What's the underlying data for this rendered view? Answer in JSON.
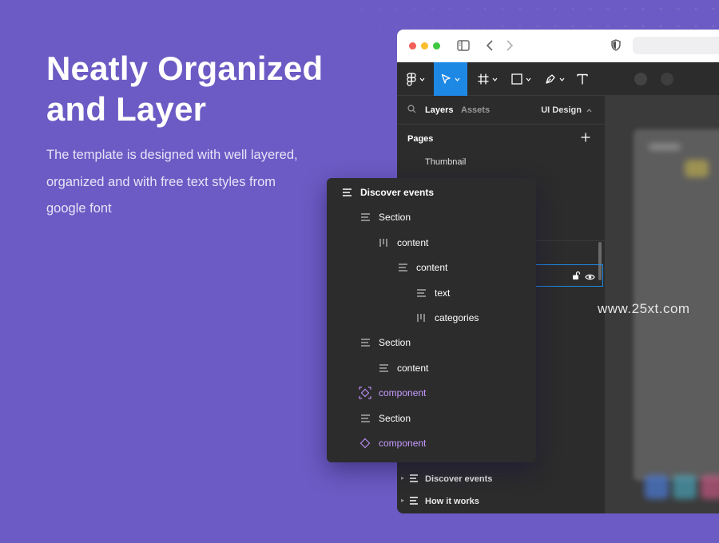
{
  "hero": {
    "title_line1": "Neatly Organized",
    "title_line2": "and Layer",
    "desc_line1": "The template is designed with well layered,",
    "desc_line2": "organized and with free text styles from",
    "desc_line3": "google font"
  },
  "panel": {
    "tabs": {
      "layers": "Layers",
      "assets": "Assets",
      "page_select": "UI Design"
    },
    "pages_heading": "Pages",
    "pages": [
      "Thumbnail"
    ],
    "bottom_layers": [
      "Discover events",
      "How it works"
    ]
  },
  "popup": {
    "layers": [
      {
        "label": "Discover events",
        "icon": "frame-lines-icon",
        "depth": 0
      },
      {
        "label": "Section",
        "icon": "frame-lines-icon",
        "depth": 1
      },
      {
        "label": "content",
        "icon": "columns-icon",
        "depth": 2
      },
      {
        "label": "content",
        "icon": "frame-lines-icon",
        "depth": 3
      },
      {
        "label": "text",
        "icon": "frame-lines-icon",
        "depth": 4
      },
      {
        "label": "categories",
        "icon": "columns-icon",
        "depth": 4
      },
      {
        "label": "Section",
        "icon": "frame-lines-icon",
        "depth": 1
      },
      {
        "label": "content",
        "icon": "frame-lines-icon",
        "depth": 2
      },
      {
        "label": "component",
        "icon": "component-main-icon",
        "depth": 1
      },
      {
        "label": "Section",
        "icon": "frame-lines-icon",
        "depth": 1
      },
      {
        "label": "component",
        "icon": "component-instance-icon",
        "depth": 1
      }
    ]
  },
  "watermark": "www.25xt.com",
  "colors": {
    "background": "#6C5BC4",
    "panel": "#2C2C2C",
    "accent_blue": "#1E88E5",
    "component_purple": "#C69BFF"
  }
}
